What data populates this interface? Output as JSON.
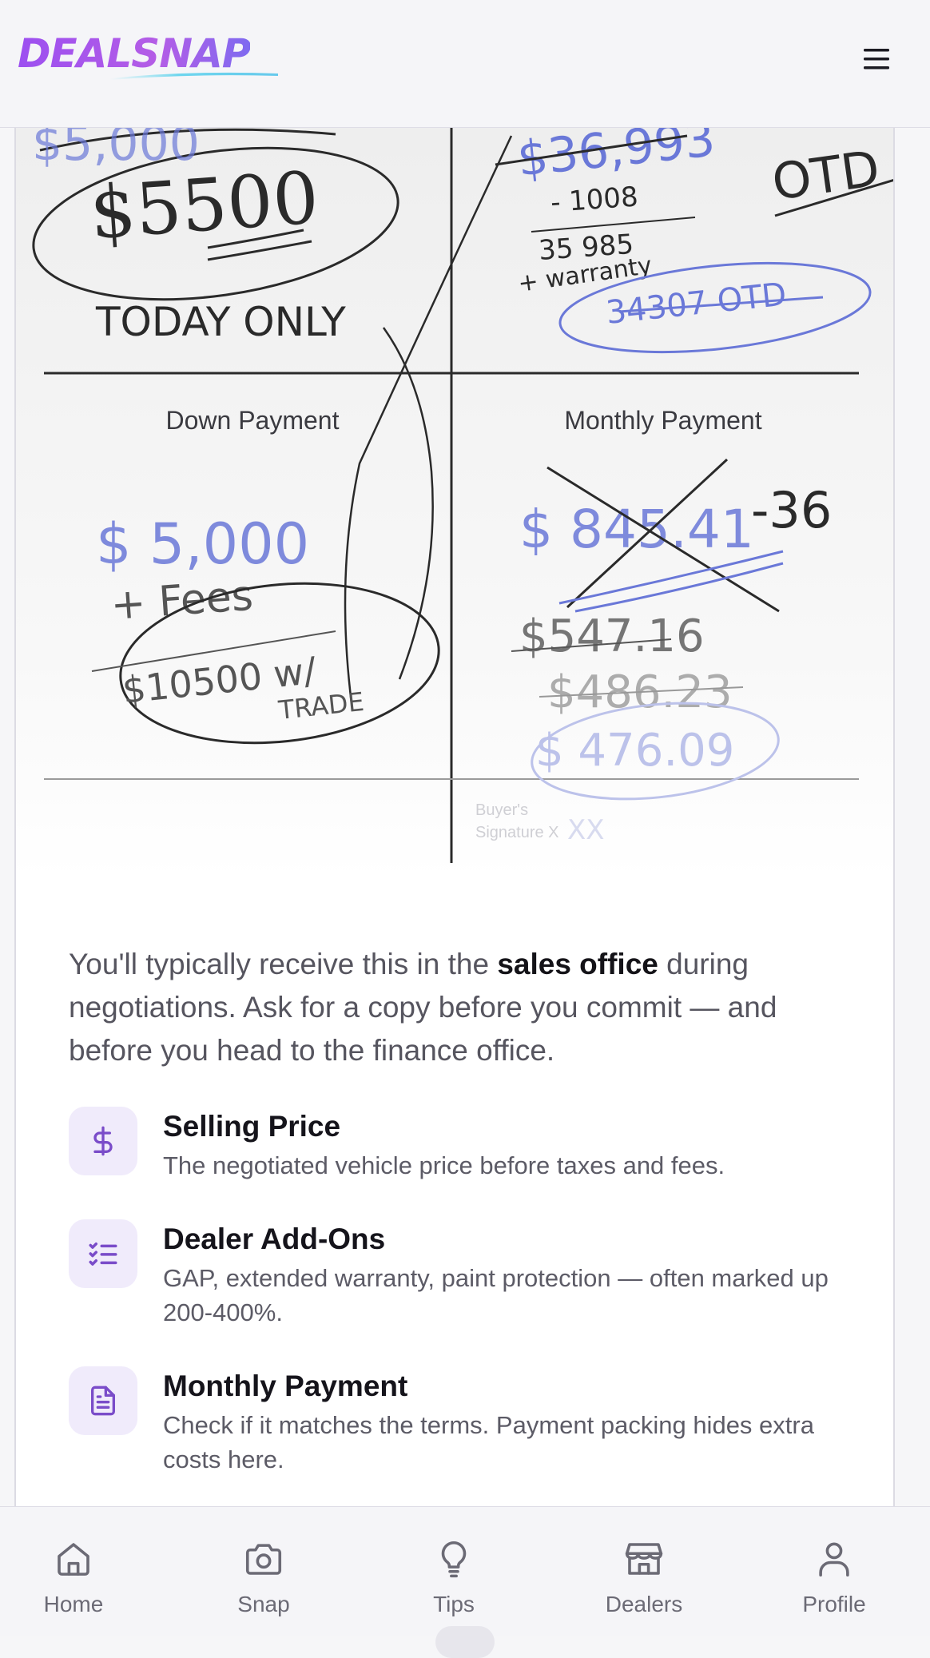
{
  "header": {
    "logo_text": "DEALSNAP",
    "menu_icon": "hamburger-menu-icon"
  },
  "document_image": {
    "labels": {
      "down_payment": "Down Payment",
      "monthly_payment": "Monthly Payment",
      "buyer_signature_line1": "Buyer's",
      "buyer_signature_line2": "Signature X"
    },
    "handwriting": {
      "price_struck": "$5,000",
      "price_circled": "$5500",
      "today_only": "TODAY ONLY",
      "total_struck": "$36,993",
      "minus": "- 1008",
      "subtotal": "35 985",
      "warranty": "+ warranty",
      "otd_circled": "34307 OTD",
      "otd_label": "OTD",
      "down_amount": "$ 5,000",
      "plus_fees": "+ Fees",
      "trade": "$10500 w/ TRADE",
      "monthly_struck": "$ 845.41",
      "term": "-36",
      "pay1": "$547.16",
      "pay2": "$486.23",
      "pay3": "$ 476.09"
    }
  },
  "intro": {
    "before": "You'll typically receive this in the ",
    "emphasis": "sales office",
    "after": " during negotiations. Ask for a copy before you commit — and before you head to the finance office."
  },
  "features": [
    {
      "icon": "dollar-sign-icon",
      "title": "Selling Price",
      "description": "The negotiated vehicle price before taxes and fees."
    },
    {
      "icon": "checklist-icon",
      "title": "Dealer Add-Ons",
      "description": "GAP, extended warranty, paint protection — often marked up 200-400%."
    },
    {
      "icon": "document-icon",
      "title": "Monthly Payment",
      "description": "Check if it matches the terms. Payment packing hides extra costs here."
    }
  ],
  "bottom_nav": [
    {
      "label": "Home",
      "icon": "home-icon"
    },
    {
      "label": "Snap",
      "icon": "camera-icon"
    },
    {
      "label": "Tips",
      "icon": "lightbulb-icon"
    },
    {
      "label": "Dealers",
      "icon": "store-icon"
    },
    {
      "label": "Profile",
      "icon": "user-icon"
    }
  ],
  "colors": {
    "brand_purple": "#9c4ff0",
    "icon_purple": "#7a4cc9",
    "icon_bg": "#f0ebfb",
    "ink_blue": "#6a78d8"
  }
}
